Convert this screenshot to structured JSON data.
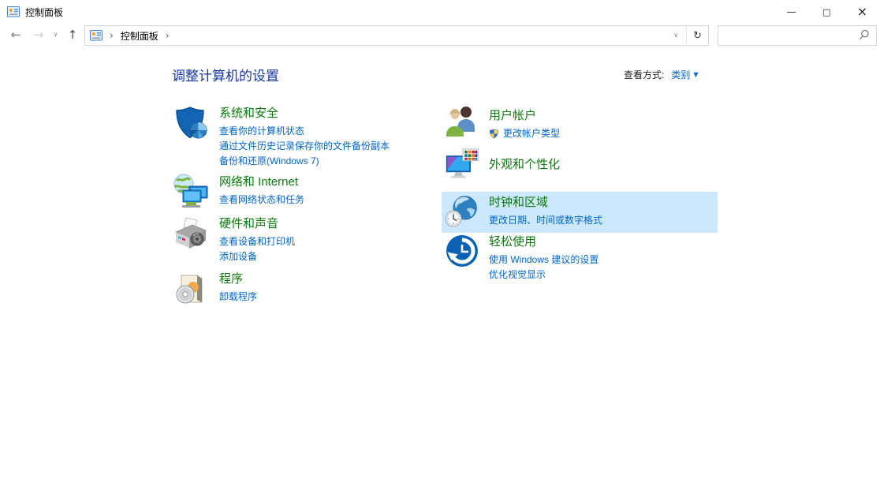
{
  "window": {
    "title": "控制面板",
    "controls": {
      "minimize": "—",
      "maximize": "□",
      "close": "×"
    }
  },
  "toolbar": {
    "back_glyph": "←",
    "forward_glyph": "→",
    "history_caret_glyph": "∨",
    "up_glyph": "↑",
    "address": {
      "separator": "›",
      "root": "控制面板",
      "dropdown_caret_glyph": "∨",
      "refresh_glyph": "↻"
    },
    "search": {
      "value": ""
    }
  },
  "header": {
    "title": "调整计算机的设置",
    "view_by_label": "查看方式:",
    "view_by_value": "类别",
    "view_by_caret": "▼"
  },
  "categories": {
    "left": [
      {
        "id": "system-security",
        "icon": "security-shield-icon",
        "title": "系统和安全",
        "links": [
          {
            "text": "查看你的计算机状态"
          },
          {
            "text": "通过文件历史记录保存你的文件备份副本"
          },
          {
            "text": "备份和还原(Windows 7)"
          }
        ]
      },
      {
        "id": "network-internet",
        "icon": "network-globe-icon",
        "title": "网络和 Internet",
        "links": [
          {
            "text": "查看网络状态和任务"
          }
        ]
      },
      {
        "id": "hardware-sound",
        "icon": "printer-icon",
        "title": "硬件和声音",
        "links": [
          {
            "text": "查看设备和打印机"
          },
          {
            "text": "添加设备"
          }
        ]
      },
      {
        "id": "programs",
        "icon": "software-box-icon",
        "title": "程序",
        "links": [
          {
            "text": "卸载程序"
          }
        ]
      }
    ],
    "right": [
      {
        "id": "user-accounts",
        "icon": "users-icon",
        "title": "用户帐户",
        "links": [
          {
            "text": "更改帐户类型",
            "shield": true
          }
        ]
      },
      {
        "id": "appearance-personalization",
        "icon": "monitor-palette-icon",
        "title": "外观和个性化",
        "links": []
      },
      {
        "id": "clock-region",
        "icon": "globe-clock-icon",
        "title": "时钟和区域",
        "highlighted": true,
        "links": [
          {
            "text": "更改日期、时间或数字格式"
          }
        ]
      },
      {
        "id": "ease-of-access",
        "icon": "accessibility-icon",
        "title": "轻松使用",
        "links": [
          {
            "text": "使用 Windows 建议的设置"
          },
          {
            "text": "优化视觉显示"
          }
        ]
      }
    ]
  },
  "colors": {
    "category_title": "#0c7a0c",
    "link": "#0066cc",
    "heading": "#17379e",
    "highlight_bg": "#cce8ff"
  }
}
